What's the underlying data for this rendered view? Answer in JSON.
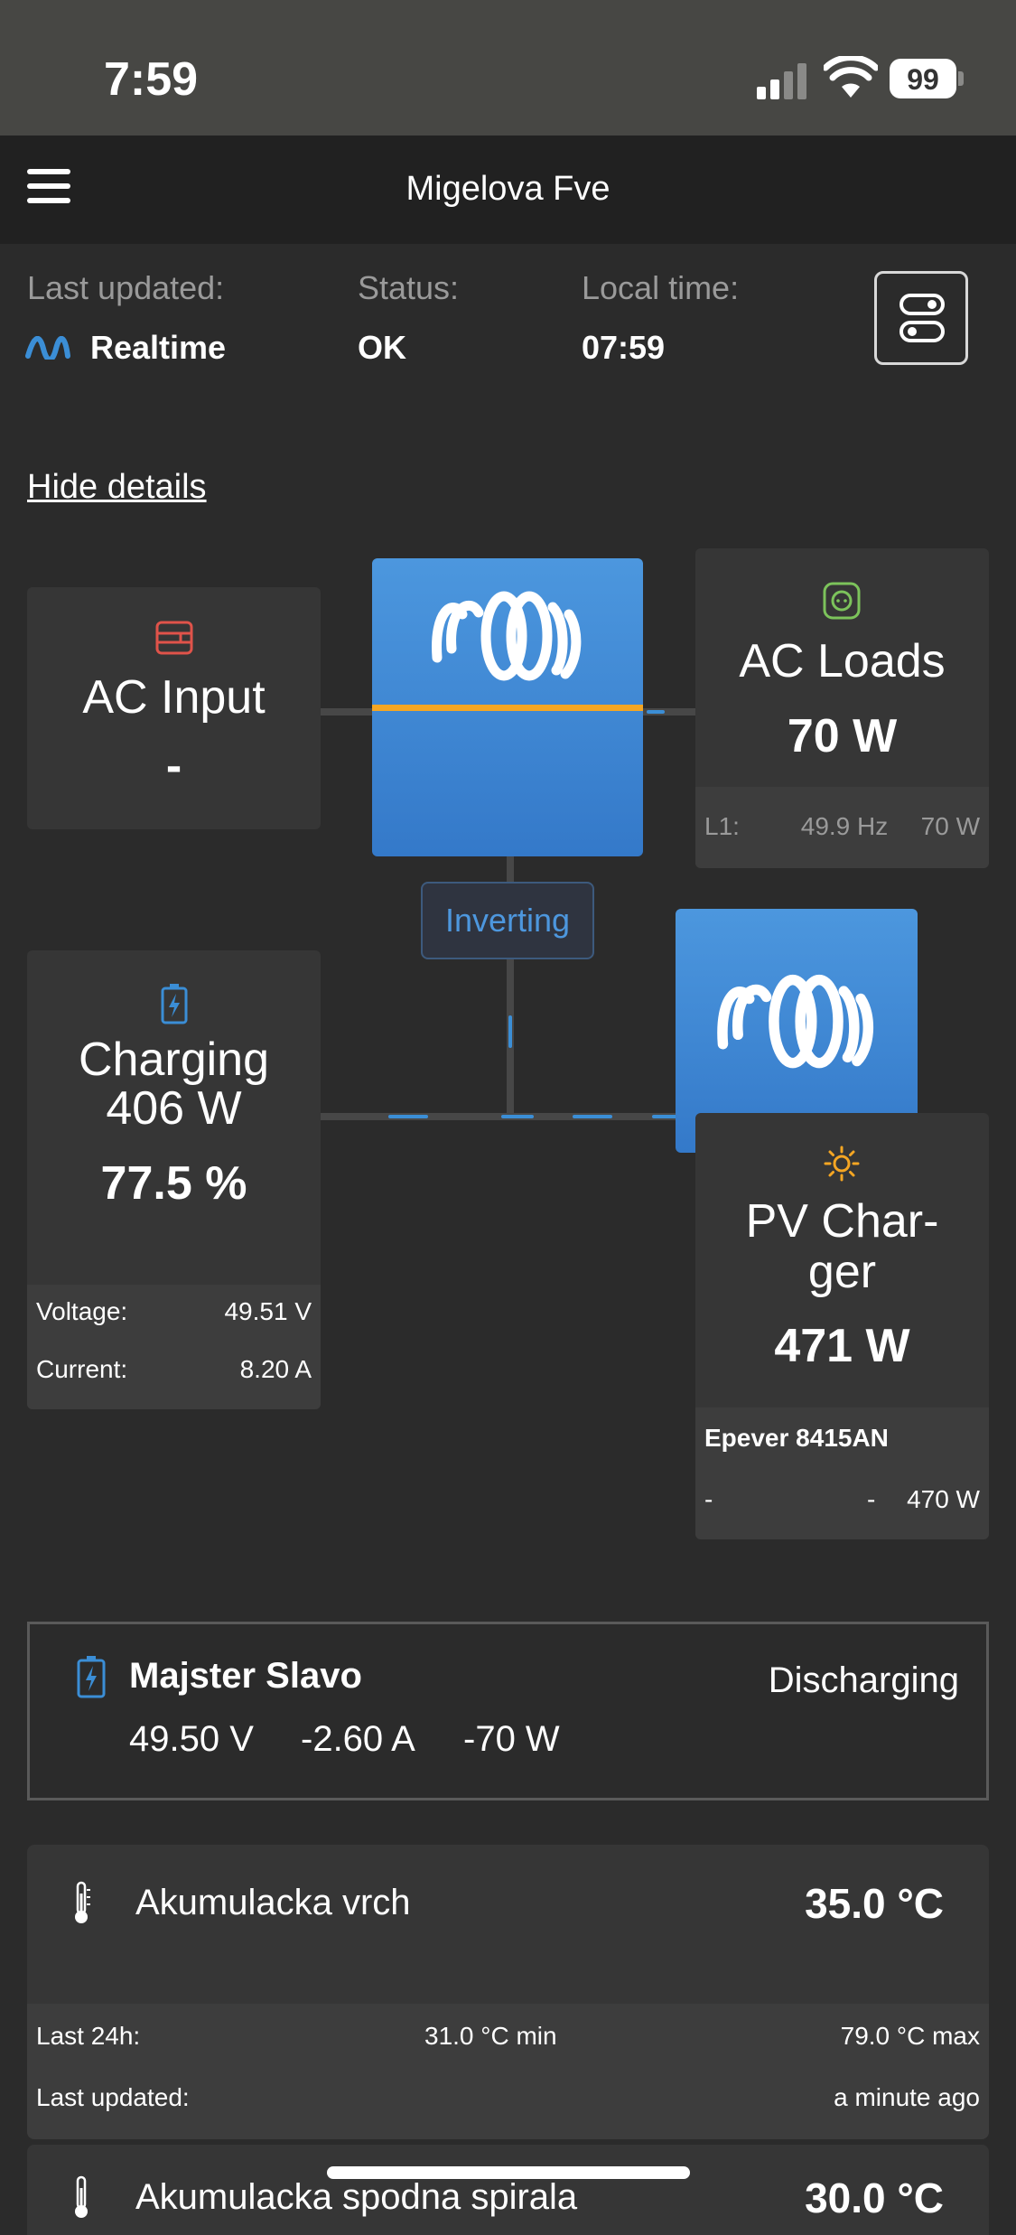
{
  "status_bar": {
    "time": "7:59",
    "battery": "99"
  },
  "nav": {
    "title": "Migelova Fve"
  },
  "info": {
    "last_updated_label": "Last updated:",
    "last_updated_value": "Realtime",
    "status_label": "Status:",
    "status_value": "OK",
    "local_time_label": "Local time:",
    "local_time_value": "07:59"
  },
  "hide_details": "Hide details",
  "ac_input": {
    "title": "AC Input",
    "value": "-"
  },
  "ac_loads": {
    "title": "AC Loads",
    "value": "70 W",
    "phase": "L1:",
    "freq": "49.9 Hz",
    "power": "70 W"
  },
  "inverter": {
    "state": "Inverting"
  },
  "battery": {
    "title": "Charging",
    "power": "406 W",
    "soc": "77.5 %",
    "voltage_label": "Voltage:",
    "voltage": "49.51 V",
    "current_label": "Current:",
    "current": "8.20 A"
  },
  "pv": {
    "title_line1": "PV Char-",
    "title_line2": "ger",
    "value": "471 W",
    "device": "Epever 8415AN",
    "col1": "-",
    "col2": "-",
    "col3": "470 W"
  },
  "battery_monitor": {
    "name": "Majster Slavo",
    "state": "Discharging",
    "voltage": "49.50 V",
    "current": "-2.60 A",
    "power": "-70 W"
  },
  "temp1": {
    "name": "Akumulacka vrch",
    "value": "35.0 °C",
    "last24_label": "Last 24h:",
    "min": "31.0 °C min",
    "max": "79.0 °C max",
    "updated_label": "Last updated:",
    "updated": "a minute ago"
  },
  "temp2": {
    "name": "Akumulacka spodna spirala",
    "value": "30.0 °C"
  },
  "colors": {
    "accent_blue": "#3b8ed6",
    "orange": "#f5a623",
    "red": "#e0534a",
    "green": "#7cc35b"
  }
}
